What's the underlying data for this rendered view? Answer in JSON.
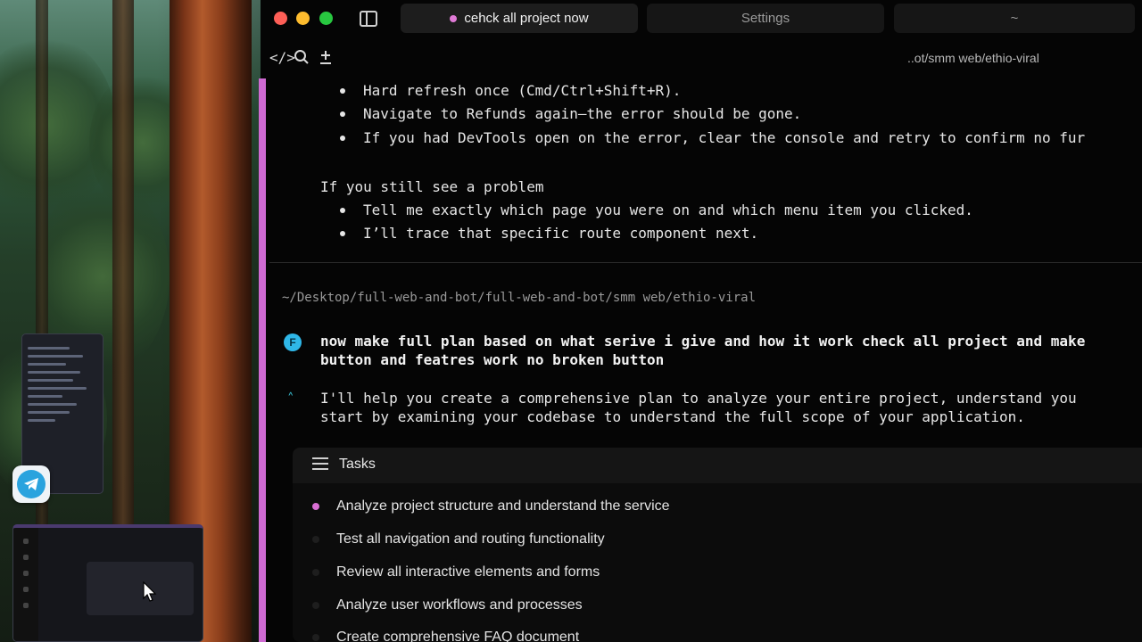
{
  "window": {
    "tabs": [
      {
        "label": "cehck all project now",
        "active": true
      },
      {
        "label": "Settings",
        "active": false
      },
      {
        "label": "~",
        "active": false
      }
    ],
    "path_short": "..ot/smm web/ethio-viral"
  },
  "toolbar": {
    "icons": [
      "code-icon",
      "search-icon",
      "plus-icon"
    ]
  },
  "output": {
    "bullets_top": [
      "Hard refresh once (Cmd/Ctrl+Shift+R).",
      "Navigate to Refunds again—the error should be gone.",
      "If you had DevTools open on the error, clear the console and retry to confirm no fur"
    ],
    "problem_heading": "If you still see a problem",
    "bullets_problem": [
      "Tell me exactly which page you were on and which menu item you clicked.",
      "I’ll trace that specific route component next."
    ]
  },
  "cwd": "~/Desktop/full-web-and-bot/full-web-and-bot/smm web/ethio-viral",
  "user_message": {
    "badge": "F",
    "line1": "now make full plan based on what serive i give and how it work check all project and make",
    "line2": "button and featres work no broken button"
  },
  "assistant_message": {
    "line1": "I'll help you create a comprehensive plan to analyze your entire project, understand you",
    "line2": "start by examining your codebase to understand the full scope of your application."
  },
  "tasks": {
    "title": "Tasks",
    "items": [
      {
        "label": "Analyze project structure and understand the service",
        "active": true
      },
      {
        "label": "Test all navigation and routing functionality",
        "active": false
      },
      {
        "label": "Review all interactive elements and forms",
        "active": false
      },
      {
        "label": "Analyze user workflows and processes",
        "active": false
      },
      {
        "label": "Create comprehensive FAQ document",
        "active": false
      }
    ]
  },
  "colors": {
    "accent": "#cf6ad2",
    "user_badge": "#2fb7e8",
    "assistant_mark": "#36b6c9"
  }
}
